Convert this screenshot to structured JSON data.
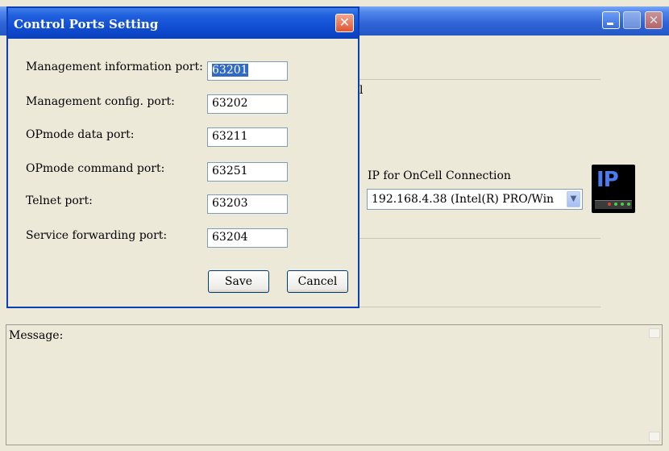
{
  "dialog": {
    "title": "Control Ports Setting",
    "close_glyph": "✕",
    "fields": [
      {
        "label": "Management information port:",
        "value": "63201"
      },
      {
        "label": "Management config. port:",
        "value": "63202"
      },
      {
        "label": "OPmode data port:",
        "value": "63211"
      },
      {
        "label": "OPmode command port:",
        "value": "63251"
      },
      {
        "label": "Telnet port:",
        "value": "63203"
      },
      {
        "label": "Service forwarding port:",
        "value": "63204"
      }
    ],
    "save_label": "Save",
    "cancel_label": "Cancel"
  },
  "main": {
    "partial_text": "l",
    "oncell_label": "IP for OnCell Connection",
    "oncell_selected": "192.168.4.38  (Intel(R) PRO/Win",
    "ip_icon_text": "IP",
    "message_label": "Message:",
    "close_glyph": "✕"
  }
}
